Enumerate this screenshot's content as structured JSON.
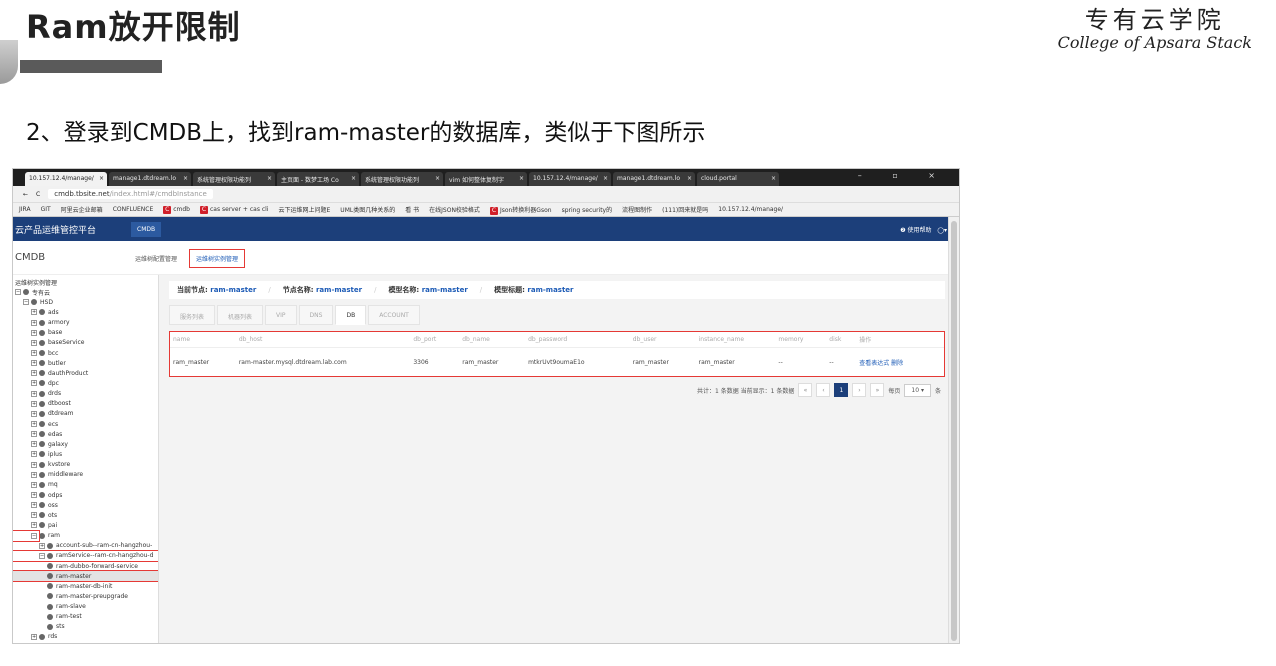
{
  "slide": {
    "title": "Ram放开限制",
    "brand_cn": "专有云学院",
    "brand_en": "College of Apsara Stack",
    "subtitle": "2、登录到CMDB上，找到ram-master的数据库，类似于下图所示"
  },
  "browser": {
    "tabs": [
      {
        "label": "10.157.12.4/manage/"
      },
      {
        "label": "manage1.dtdream.lo"
      },
      {
        "label": "系统管理权限功能列"
      },
      {
        "label": "主页面 - 数梦工场 Co"
      },
      {
        "label": "系统管理权限功能列"
      },
      {
        "label": "vim 如何整体复制字"
      },
      {
        "label": "10.157.12.4/manage/"
      },
      {
        "label": "manage1.dtdream.lo"
      },
      {
        "label": "cloud.portal"
      }
    ],
    "tab_close": "×",
    "window_controls": "– ▫ ×",
    "url_host": "cmdb.tbsite.net",
    "url_path": "/index.html#/cmdbInstance",
    "bookmarks": [
      "JIRA",
      "GIT",
      "阿里云企业邮箱",
      "CONFLUENCE",
      "cmdb",
      "cas server + cas cli",
      "云下运维网上问题E",
      "UML类图几种关系的",
      "看 书",
      "在线JSON校验格式",
      "Json转换利器Gson",
      "spring security的",
      "流程图制作",
      "(111)回来就是吗",
      "10.157.12.4/manage/"
    ],
    "bookmark_c_marks": [
      "C",
      "C",
      "C"
    ]
  },
  "app": {
    "title": "云产品运维管控平台",
    "top_tab": "CMDB",
    "help": "❷ 使用帮助",
    "user": "◯▾"
  },
  "cmdb": {
    "title": "CMDB",
    "tab1": "运维树配置管理",
    "tab2": "运维树实例管理"
  },
  "tree": {
    "nodes": [
      {
        "label": "运维树实例管理",
        "level": 0,
        "expand": "",
        "icon": false
      },
      {
        "label": "专有云",
        "level": 0,
        "expand": "−",
        "icon": true
      },
      {
        "label": "HSD",
        "level": 1,
        "expand": "−",
        "icon": true
      },
      {
        "label": "ads",
        "level": 2,
        "expand": "+",
        "icon": true
      },
      {
        "label": "armory",
        "level": 2,
        "expand": "+",
        "icon": true
      },
      {
        "label": "base",
        "level": 2,
        "expand": "+",
        "icon": true
      },
      {
        "label": "baseService",
        "level": 2,
        "expand": "+",
        "icon": true
      },
      {
        "label": "bcc",
        "level": 2,
        "expand": "+",
        "icon": true
      },
      {
        "label": "butler",
        "level": 2,
        "expand": "+",
        "icon": true
      },
      {
        "label": "dauthProduct",
        "level": 2,
        "expand": "+",
        "icon": true
      },
      {
        "label": "dpc",
        "level": 2,
        "expand": "+",
        "icon": true
      },
      {
        "label": "drds",
        "level": 2,
        "expand": "+",
        "icon": true
      },
      {
        "label": "dtboost",
        "level": 2,
        "expand": "+",
        "icon": true
      },
      {
        "label": "dtdream",
        "level": 2,
        "expand": "+",
        "icon": true
      },
      {
        "label": "ecs",
        "level": 2,
        "expand": "+",
        "icon": true
      },
      {
        "label": "edas",
        "level": 2,
        "expand": "+",
        "icon": true
      },
      {
        "label": "galaxy",
        "level": 2,
        "expand": "+",
        "icon": true
      },
      {
        "label": "iplus",
        "level": 2,
        "expand": "+",
        "icon": true
      },
      {
        "label": "kvstore",
        "level": 2,
        "expand": "+",
        "icon": true
      },
      {
        "label": "middleware",
        "level": 2,
        "expand": "+",
        "icon": true
      },
      {
        "label": "mq",
        "level": 2,
        "expand": "+",
        "icon": true
      },
      {
        "label": "odps",
        "level": 2,
        "expand": "+",
        "icon": true
      },
      {
        "label": "oss",
        "level": 2,
        "expand": "+",
        "icon": true
      },
      {
        "label": "ots",
        "level": 2,
        "expand": "+",
        "icon": true
      },
      {
        "label": "pai",
        "level": 2,
        "expand": "+",
        "icon": true
      },
      {
        "label": "ram",
        "level": 2,
        "expand": "−",
        "icon": true,
        "boxed": true
      },
      {
        "label": "account-sub--ram-cn-hangzhou-",
        "level": 3,
        "expand": "+",
        "icon": true
      },
      {
        "label": "ramService--ram-cn-hangzhou-d",
        "level": 3,
        "expand": "−",
        "icon": true,
        "boxed": true
      },
      {
        "label": "ram-dubbo-forward-service",
        "level": 4,
        "expand": "",
        "icon": true
      },
      {
        "label": "ram-master",
        "level": 4,
        "expand": "",
        "icon": true,
        "boxed": true,
        "selected": true
      },
      {
        "label": "ram-master-db-init",
        "level": 4,
        "expand": "",
        "icon": true
      },
      {
        "label": "ram-master-preupgrade",
        "level": 4,
        "expand": "",
        "icon": true
      },
      {
        "label": "ram-slave",
        "level": 4,
        "expand": "",
        "icon": true
      },
      {
        "label": "ram-test",
        "level": 4,
        "expand": "",
        "icon": true
      },
      {
        "label": "sts",
        "level": 4,
        "expand": "",
        "icon": true
      },
      {
        "label": "rds",
        "level": 2,
        "expand": "+",
        "icon": true
      }
    ]
  },
  "breadcrumb": {
    "node_label": "当前节点:",
    "node_value": "ram-master",
    "name_label": "节点名称:",
    "name_value": "ram-master",
    "model_label": "模型名称:",
    "model_value": "ram-master",
    "tag_label": "模型标题:",
    "tag_value": "ram-master",
    "sep": "/"
  },
  "tabs": [
    {
      "label": "服务列表",
      "active": false
    },
    {
      "label": "机器列表",
      "active": false
    },
    {
      "label": "VIP",
      "active": false
    },
    {
      "label": "DNS",
      "active": false
    },
    {
      "label": "DB",
      "active": true
    },
    {
      "label": "ACCOUNT",
      "active": false
    }
  ],
  "table": {
    "columns": [
      "name",
      "db_host",
      "db_port",
      "db_name",
      "db_password",
      "db_user",
      "instance_name",
      "memory",
      "disk",
      "操作"
    ],
    "rows": [
      [
        "ram_master",
        "ram-master.mysql.dtdream.lab.com",
        "3306",
        "ram_master",
        "mtkrUvt9oumaE1o",
        "ram_master",
        "ram_master",
        "--",
        "--",
        "查看表达式 删除"
      ]
    ]
  },
  "pager": {
    "summary": "共计：1 条数据  当前显示：1 条数据",
    "first": "«",
    "prev": "‹",
    "current": "1",
    "next": "›",
    "last": "»",
    "per_page_label": "每页",
    "per_page": "10 ▾",
    "unit": "条"
  },
  "colors": {
    "app_bar": "#1c3f7a",
    "highlight_box": "#e53935",
    "link": "#1d5bb6"
  }
}
